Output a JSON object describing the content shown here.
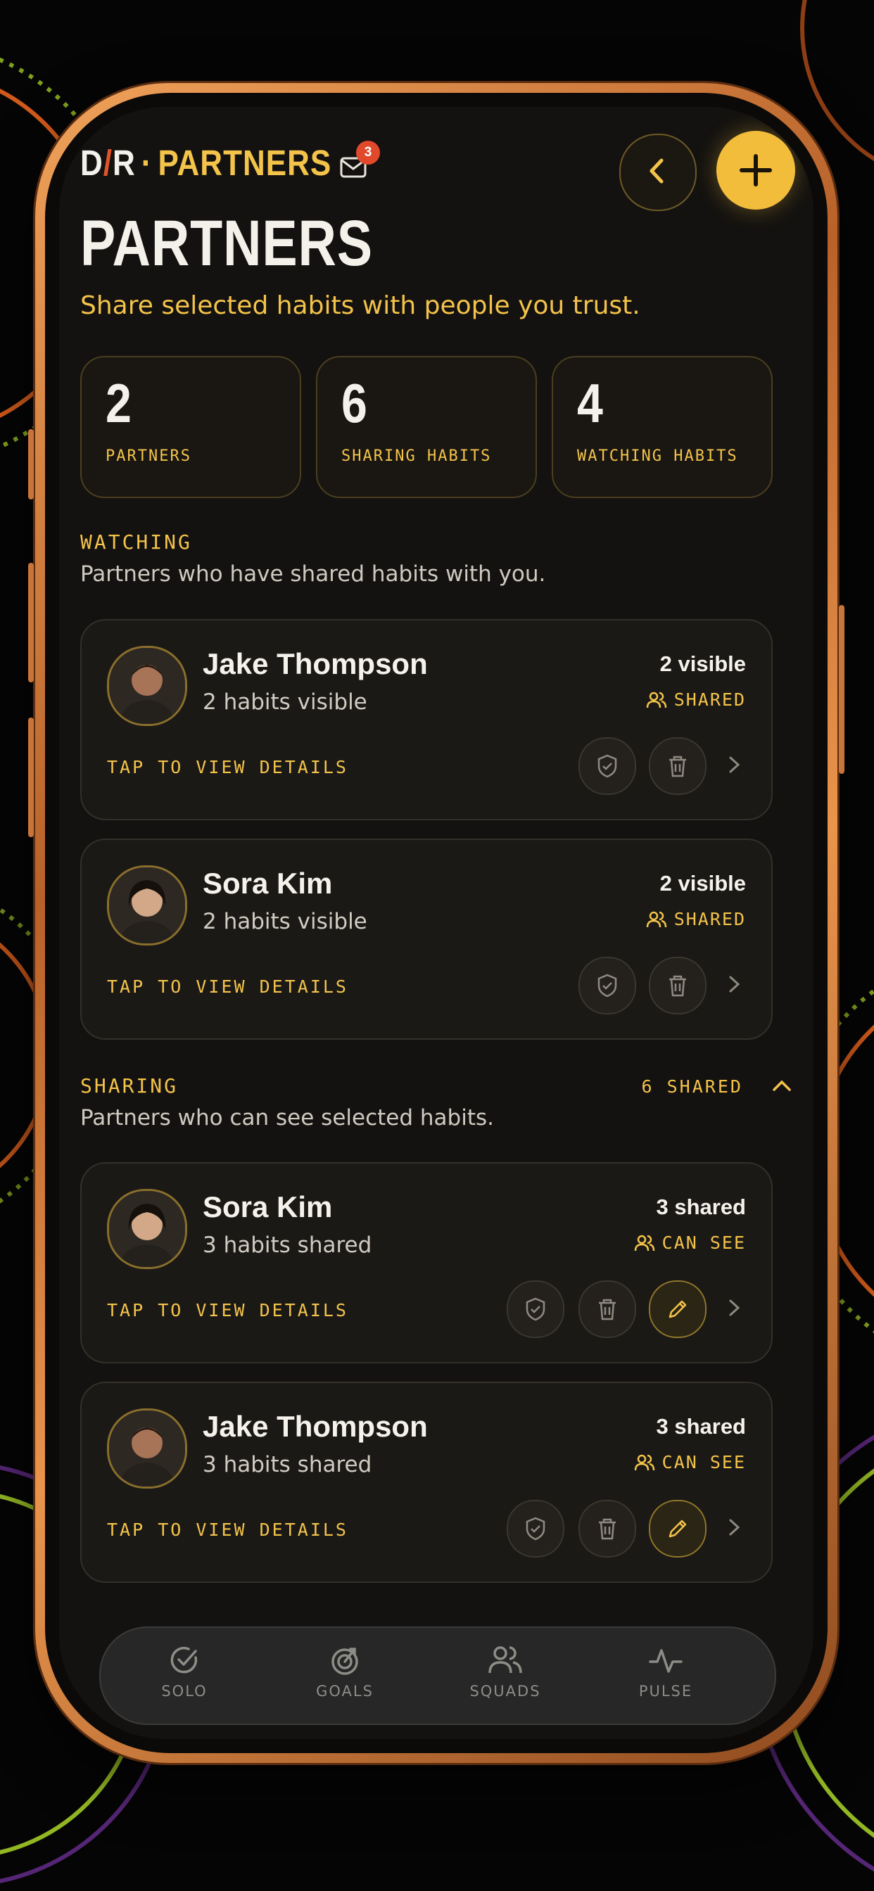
{
  "header": {
    "logo_left": "D",
    "logo_slash": "/",
    "logo_right": "R",
    "logo_dot": "·",
    "brand": "PARTNERS",
    "notification_count": "3"
  },
  "page": {
    "title": "PARTNERS",
    "subtitle": "Share selected habits with people you trust."
  },
  "stats": [
    {
      "value": "2",
      "label": "PARTNERS"
    },
    {
      "value": "6",
      "label": "SHARING HABITS"
    },
    {
      "value": "4",
      "label": "WATCHING HABITS"
    }
  ],
  "watching": {
    "heading": "WATCHING",
    "description": "Partners who have shared habits with you.",
    "cards": [
      {
        "name": "Jake Thompson",
        "sub": "2 habits visible",
        "count": "2 visible",
        "status": "SHARED",
        "action": "TAP TO VIEW DETAILS"
      },
      {
        "name": "Sora Kim",
        "sub": "2 habits visible",
        "count": "2 visible",
        "status": "SHARED",
        "action": "TAP TO VIEW DETAILS"
      }
    ]
  },
  "sharing": {
    "heading": "SHARING",
    "description": "Partners who can see selected habits.",
    "meta": "6 SHARED",
    "cards": [
      {
        "name": "Sora Kim",
        "sub": "3 habits shared",
        "count": "3 shared",
        "status": "CAN SEE",
        "action": "TAP TO VIEW DETAILS"
      },
      {
        "name": "Jake Thompson",
        "sub": "3 habits shared",
        "count": "3 shared",
        "status": "CAN SEE",
        "action": "TAP TO VIEW DETAILS"
      }
    ]
  },
  "tabs": [
    {
      "label": "SOLO",
      "icon": "check-circle-icon"
    },
    {
      "label": "GOALS",
      "icon": "target-icon"
    },
    {
      "label": "SQUADS",
      "icon": "users-icon"
    },
    {
      "label": "PULSE",
      "icon": "pulse-icon"
    }
  ],
  "colors": {
    "accent": "#f3c34a",
    "background": "#141210",
    "notification": "#e2482a",
    "frame": "#d9843f"
  }
}
